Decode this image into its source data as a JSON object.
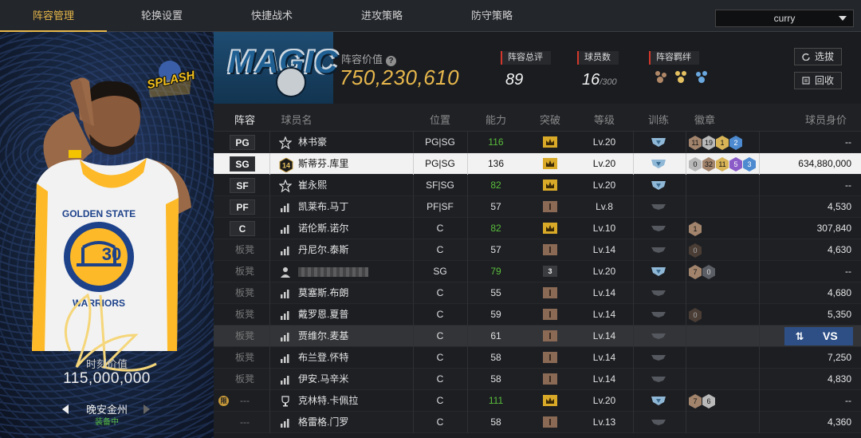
{
  "tabs": [
    {
      "label": "阵容管理",
      "active": true
    },
    {
      "label": "轮换设置",
      "active": false
    },
    {
      "label": "快捷战术",
      "active": false
    },
    {
      "label": "进攻策略",
      "active": false
    },
    {
      "label": "防守策略",
      "active": false
    }
  ],
  "dropdown": {
    "value": "curry"
  },
  "card": {
    "logo_text": "SPLASH",
    "jersey_team": "GOLDEN STATE",
    "jersey_team2": "WARRIORS",
    "jersey_number": "30",
    "moment_label": "时刻价值",
    "moment_value": "115,000,000",
    "name": "晚安金州",
    "status": "装备中"
  },
  "header": {
    "team_logo": "MAGIC",
    "lineup_value_label": "阵容价值",
    "lineup_value": "750,230,610",
    "total_rating_label": "阵容总评",
    "total_rating": "89",
    "player_count_label": "球员数",
    "player_count": "16",
    "player_count_max": "/300",
    "bond_label": "阵容羁绊",
    "select_button": "选拔",
    "recycle_button": "回收"
  },
  "table": {
    "columns": [
      "阵容",
      "球员名",
      "位置",
      "能力",
      "突破",
      "等级",
      "训练",
      "徽章",
      "球员身价"
    ],
    "rows": [
      {
        "slot": "PG",
        "name": "林书豪",
        "icon": "star",
        "pos": "PG|SG",
        "ability": "116",
        "green": true,
        "brk": "gold",
        "level": "Lv.20",
        "train": true,
        "badges": [
          [
            "bronze",
            "11"
          ],
          [
            "silver",
            "19"
          ],
          [
            "gold",
            "1"
          ],
          [
            "blue",
            "2"
          ]
        ],
        "value": "--"
      },
      {
        "slot": "SG",
        "name": "斯蒂芬.库里",
        "icon": "num14",
        "pos": "PG|SG",
        "ability": "136",
        "green": false,
        "brk": "gold",
        "level": "Lv.20",
        "train": true,
        "badges": [
          [
            "silver",
            "0"
          ],
          [
            "bronze",
            "32"
          ],
          [
            "gold",
            "11"
          ],
          [
            "purple",
            "5"
          ],
          [
            "blue",
            "3"
          ]
        ],
        "value": "634,880,000",
        "selected": true
      },
      {
        "slot": "SF",
        "name": "崔永熙",
        "icon": "star",
        "pos": "SF|SG",
        "ability": "82",
        "green": true,
        "brk": "gold",
        "level": "Lv.20",
        "train": true,
        "badges": [],
        "value": "--"
      },
      {
        "slot": "PF",
        "name": "凯莱布.马丁",
        "icon": "bars",
        "pos": "PF|SF",
        "ability": "57",
        "green": false,
        "brk": "brown",
        "level": "Lv.8",
        "train": false,
        "badges": [],
        "value": "4,530"
      },
      {
        "slot": "C",
        "name": "诺伦斯.诺尔",
        "icon": "bars",
        "pos": "C",
        "ability": "82",
        "green": true,
        "brk": "gold",
        "level": "Lv.10",
        "train": false,
        "badges": [
          [
            "bronze",
            "1"
          ]
        ],
        "value": "307,840"
      },
      {
        "slot": "板凳",
        "name": "丹尼尔.泰斯",
        "icon": "bars",
        "pos": "C",
        "ability": "57",
        "green": false,
        "brk": "brown",
        "level": "Lv.14",
        "train": false,
        "badges": [
          [
            "dim",
            "0"
          ]
        ],
        "value": "4,630"
      },
      {
        "slot": "板凳",
        "name": "",
        "icon": "person",
        "pos": "SG",
        "ability": "79",
        "green": true,
        "brk": "dark3",
        "level": "Lv.20",
        "train": true,
        "badges": [
          [
            "bronze",
            "7"
          ],
          [
            "grey2",
            "0"
          ]
        ],
        "value": "--",
        "blurred": true
      },
      {
        "slot": "板凳",
        "name": "莫塞斯.布朗",
        "icon": "bars",
        "pos": "C",
        "ability": "55",
        "green": false,
        "brk": "brown",
        "level": "Lv.14",
        "train": false,
        "badges": [],
        "value": "4,680"
      },
      {
        "slot": "板凳",
        "name": "戴罗恩.夏普",
        "icon": "bars",
        "pos": "C",
        "ability": "59",
        "green": false,
        "brk": "brown",
        "level": "Lv.14",
        "train": false,
        "badges": [
          [
            "dim",
            "0"
          ]
        ],
        "value": "5,350"
      },
      {
        "slot": "板凳",
        "name": "贾维尔.麦基",
        "icon": "bars",
        "pos": "C",
        "ability": "61",
        "green": false,
        "brk": "brown",
        "level": "Lv.14",
        "train": false,
        "badges": [],
        "value": "",
        "highlight": true,
        "vs": "VS"
      },
      {
        "slot": "板凳",
        "name": "布兰登.怀特",
        "icon": "bars",
        "pos": "C",
        "ability": "58",
        "green": false,
        "brk": "brown",
        "level": "Lv.14",
        "train": false,
        "badges": [],
        "value": "7,250"
      },
      {
        "slot": "板凳",
        "name": "伊安.马辛米",
        "icon": "bars",
        "pos": "C",
        "ability": "58",
        "green": false,
        "brk": "brown",
        "level": "Lv.14",
        "train": false,
        "badges": [],
        "value": "4,830"
      },
      {
        "slot": "---",
        "name": "克林特.卡佩拉",
        "icon": "trophy",
        "pos": "C",
        "ability": "111",
        "green": true,
        "brk": "gold",
        "level": "Lv.20",
        "train": true,
        "badges": [
          [
            "bronze",
            "7"
          ],
          [
            "silver",
            "6"
          ]
        ],
        "value": "--",
        "mark": "限"
      },
      {
        "slot": "---",
        "name": "格雷格.门罗",
        "icon": "bars",
        "pos": "C",
        "ability": "58",
        "green": false,
        "brk": "brown",
        "level": "Lv.13",
        "train": false,
        "badges": [],
        "value": "4,360"
      }
    ]
  },
  "colors": {
    "accent": "#e8b84a",
    "green": "#5bbf3c",
    "red_bar": "#d4372c",
    "selected_row": "#f2f2f2"
  }
}
